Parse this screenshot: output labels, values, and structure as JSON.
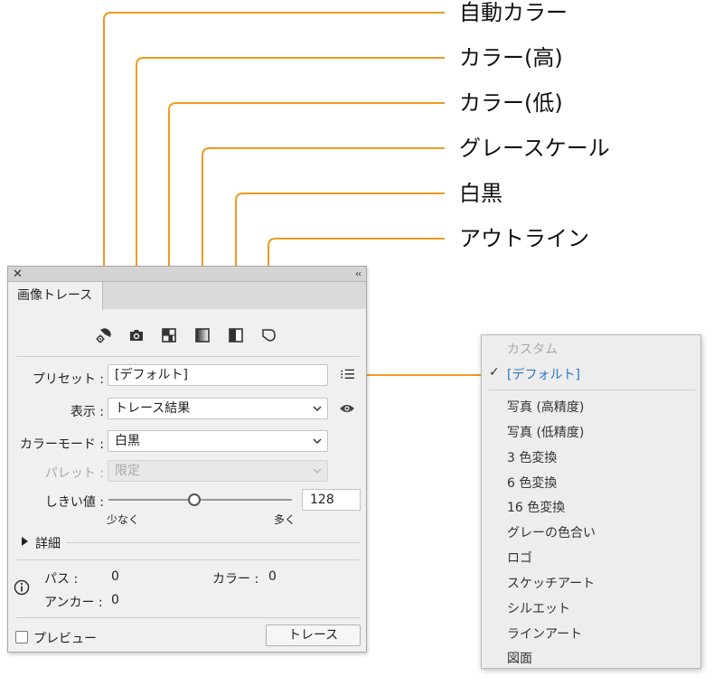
{
  "callouts": {
    "auto_color": "自動カラー",
    "high_color": "カラー(高)",
    "low_color": "カラー(低)",
    "grayscale": "グレースケール",
    "black_white": "白黒",
    "outline": "アウトライン"
  },
  "colors": {
    "leader": "#ef9a22",
    "selected": "#2a76c6"
  },
  "panel": {
    "close_glyph": "✕",
    "collapse_glyph": "‹‹",
    "tab_label": "画像トレース",
    "preset": {
      "label": "プリセット :",
      "value": "[デフォルト]",
      "list_glyph": "⁝☰"
    },
    "view": {
      "label": "表示 :",
      "value": "トレース結果"
    },
    "mode": {
      "label": "カラーモード :",
      "value": "白黒"
    },
    "palette": {
      "label": "パレット :",
      "value": "限定"
    },
    "threshold": {
      "label": "しきい値 :",
      "value": "128",
      "min_label": "少なく",
      "max_label": "多く",
      "fraction": 0.47
    },
    "advanced_label": "詳細",
    "stats": {
      "paths_label": "パス :",
      "paths_value": "0",
      "colors_label": "カラー :",
      "colors_value": "0",
      "anchors_label": "アンカー :",
      "anchors_value": "0"
    },
    "preview_label": "プレビュー",
    "trace_button": "トレース"
  },
  "menu": {
    "items": [
      "カスタム",
      "[デフォルト]",
      "写真 (高精度)",
      "写真 (低精度)",
      "3 色変換",
      "6 色変換",
      "16 色変換",
      "グレーの色合い",
      "ロゴ",
      "スケッチアート",
      "シルエット",
      "ラインアート",
      "図面"
    ],
    "check_glyph": "✓"
  }
}
